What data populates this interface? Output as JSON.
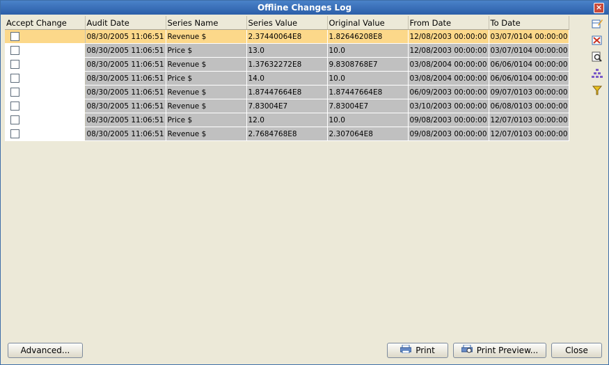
{
  "window": {
    "title": "Offline Changes Log"
  },
  "table": {
    "columns": [
      "Accept Change",
      "Audit Date",
      "Series Name",
      "Series Value",
      "Original Value",
      "From Date",
      "To Date"
    ],
    "rows": [
      {
        "accepted": false,
        "audit_date": "08/30/2005 11:06:51",
        "series_name": "Revenue $",
        "series_value": "2.37440064E8",
        "original_value": "1.82646208E8",
        "from_date": "12/08/2003 00:00:00",
        "to_date": "03/07/0104 00:00:00"
      },
      {
        "accepted": false,
        "audit_date": "08/30/2005 11:06:51",
        "series_name": "Price $",
        "series_value": "13.0",
        "original_value": "10.0",
        "from_date": "12/08/2003 00:00:00",
        "to_date": "03/07/0104 00:00:00"
      },
      {
        "accepted": false,
        "audit_date": "08/30/2005 11:06:51",
        "series_name": "Revenue $",
        "series_value": "1.37632272E8",
        "original_value": "9.8308768E7",
        "from_date": "03/08/2004 00:00:00",
        "to_date": "06/06/0104 00:00:00"
      },
      {
        "accepted": false,
        "audit_date": "08/30/2005 11:06:51",
        "series_name": "Price $",
        "series_value": "14.0",
        "original_value": "10.0",
        "from_date": "03/08/2004 00:00:00",
        "to_date": "06/06/0104 00:00:00"
      },
      {
        "accepted": false,
        "audit_date": "08/30/2005 11:06:51",
        "series_name": "Revenue $",
        "series_value": "1.87447664E8",
        "original_value": "1.87447664E8",
        "from_date": "06/09/2003 00:00:00",
        "to_date": "09/07/0103 00:00:00"
      },
      {
        "accepted": false,
        "audit_date": "08/30/2005 11:06:51",
        "series_name": "Revenue $",
        "series_value": "7.83004E7",
        "original_value": "7.83004E7",
        "from_date": "03/10/2003 00:00:00",
        "to_date": "06/08/0103 00:00:00"
      },
      {
        "accepted": false,
        "audit_date": "08/30/2005 11:06:51",
        "series_name": "Price $",
        "series_value": "12.0",
        "original_value": "10.0",
        "from_date": "09/08/2003 00:00:00",
        "to_date": "12/07/0103 00:00:00"
      },
      {
        "accepted": false,
        "audit_date": "08/30/2005 11:06:51",
        "series_name": "Revenue $",
        "series_value": "2.7684768E8",
        "original_value": "2.307064E8",
        "from_date": "09/08/2003 00:00:00",
        "to_date": "12/07/0103 00:00:00"
      }
    ]
  },
  "side_tools": [
    {
      "icon": "edit-table-icon"
    },
    {
      "icon": "delete-table-icon"
    },
    {
      "icon": "find-icon"
    },
    {
      "icon": "hierarchy-icon"
    },
    {
      "icon": "filter-icon"
    }
  ],
  "buttons": {
    "advanced": "Advanced...",
    "print": "Print",
    "print_preview": "Print Preview...",
    "close": "Close"
  },
  "colors": {
    "selected_row": "#fcd88a",
    "cell_bg": "#c0c0c0",
    "title_bar": "#2b5ea8"
  }
}
